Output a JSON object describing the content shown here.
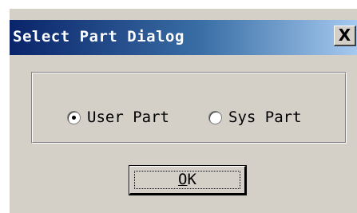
{
  "dialog": {
    "title": "Select Part Dialog",
    "close_glyph": "X",
    "colors": {
      "face": "#d4d0c8",
      "title_start": "#0a246a",
      "title_end": "#a6caf0",
      "title_text": "#ffffff"
    }
  },
  "part_type": {
    "options": [
      {
        "label": "User Part",
        "selected": true
      },
      {
        "label": "Sys Part",
        "selected": false
      }
    ]
  },
  "buttons": {
    "ok_label_mnemonic": "O",
    "ok_label_rest": "K"
  }
}
